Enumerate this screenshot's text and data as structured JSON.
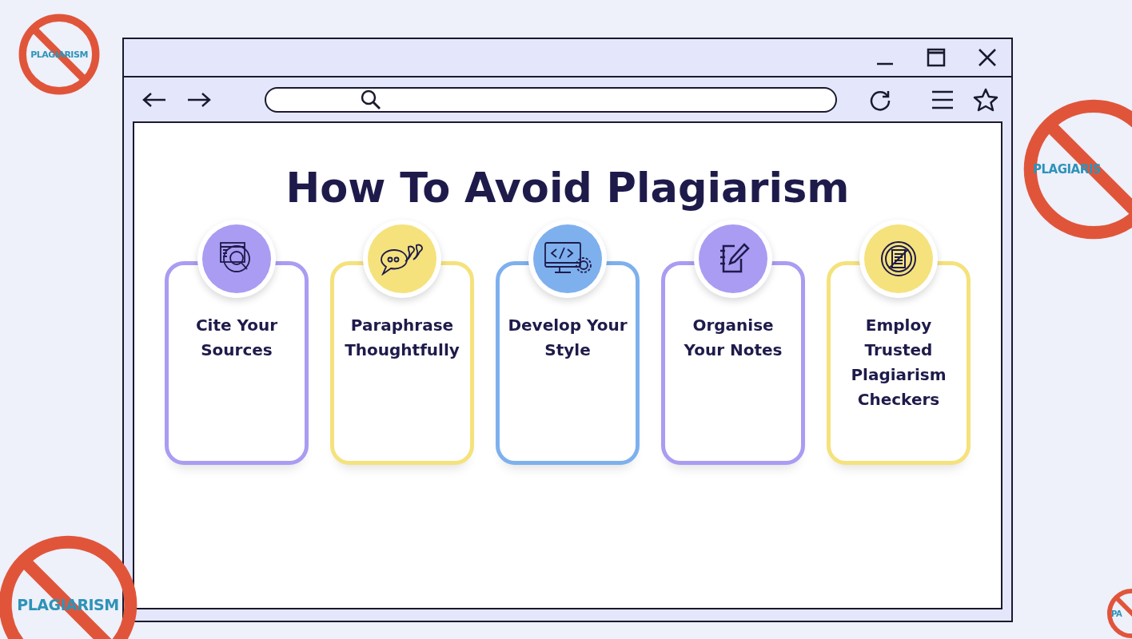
{
  "heading": "How To Avoid Plagiarism",
  "cards": [
    {
      "title": "Cite Your Sources",
      "color": "#a99cf2"
    },
    {
      "title": "Paraphrase Thoughtfully",
      "color": "#f5e27c"
    },
    {
      "title": "Develop Your Style",
      "color": "#7eb0ee"
    },
    {
      "title": "Organise Your Notes",
      "color": "#a99cf2"
    },
    {
      "title": "Employ Trusted Plagiarism Checkers",
      "color": "#f5e27c"
    }
  ],
  "stickers": [
    {
      "text": "PLAGIARISM"
    },
    {
      "text": "PLAGIARIS"
    },
    {
      "text": "PLAGIARISM"
    },
    {
      "text": "PA"
    }
  ]
}
